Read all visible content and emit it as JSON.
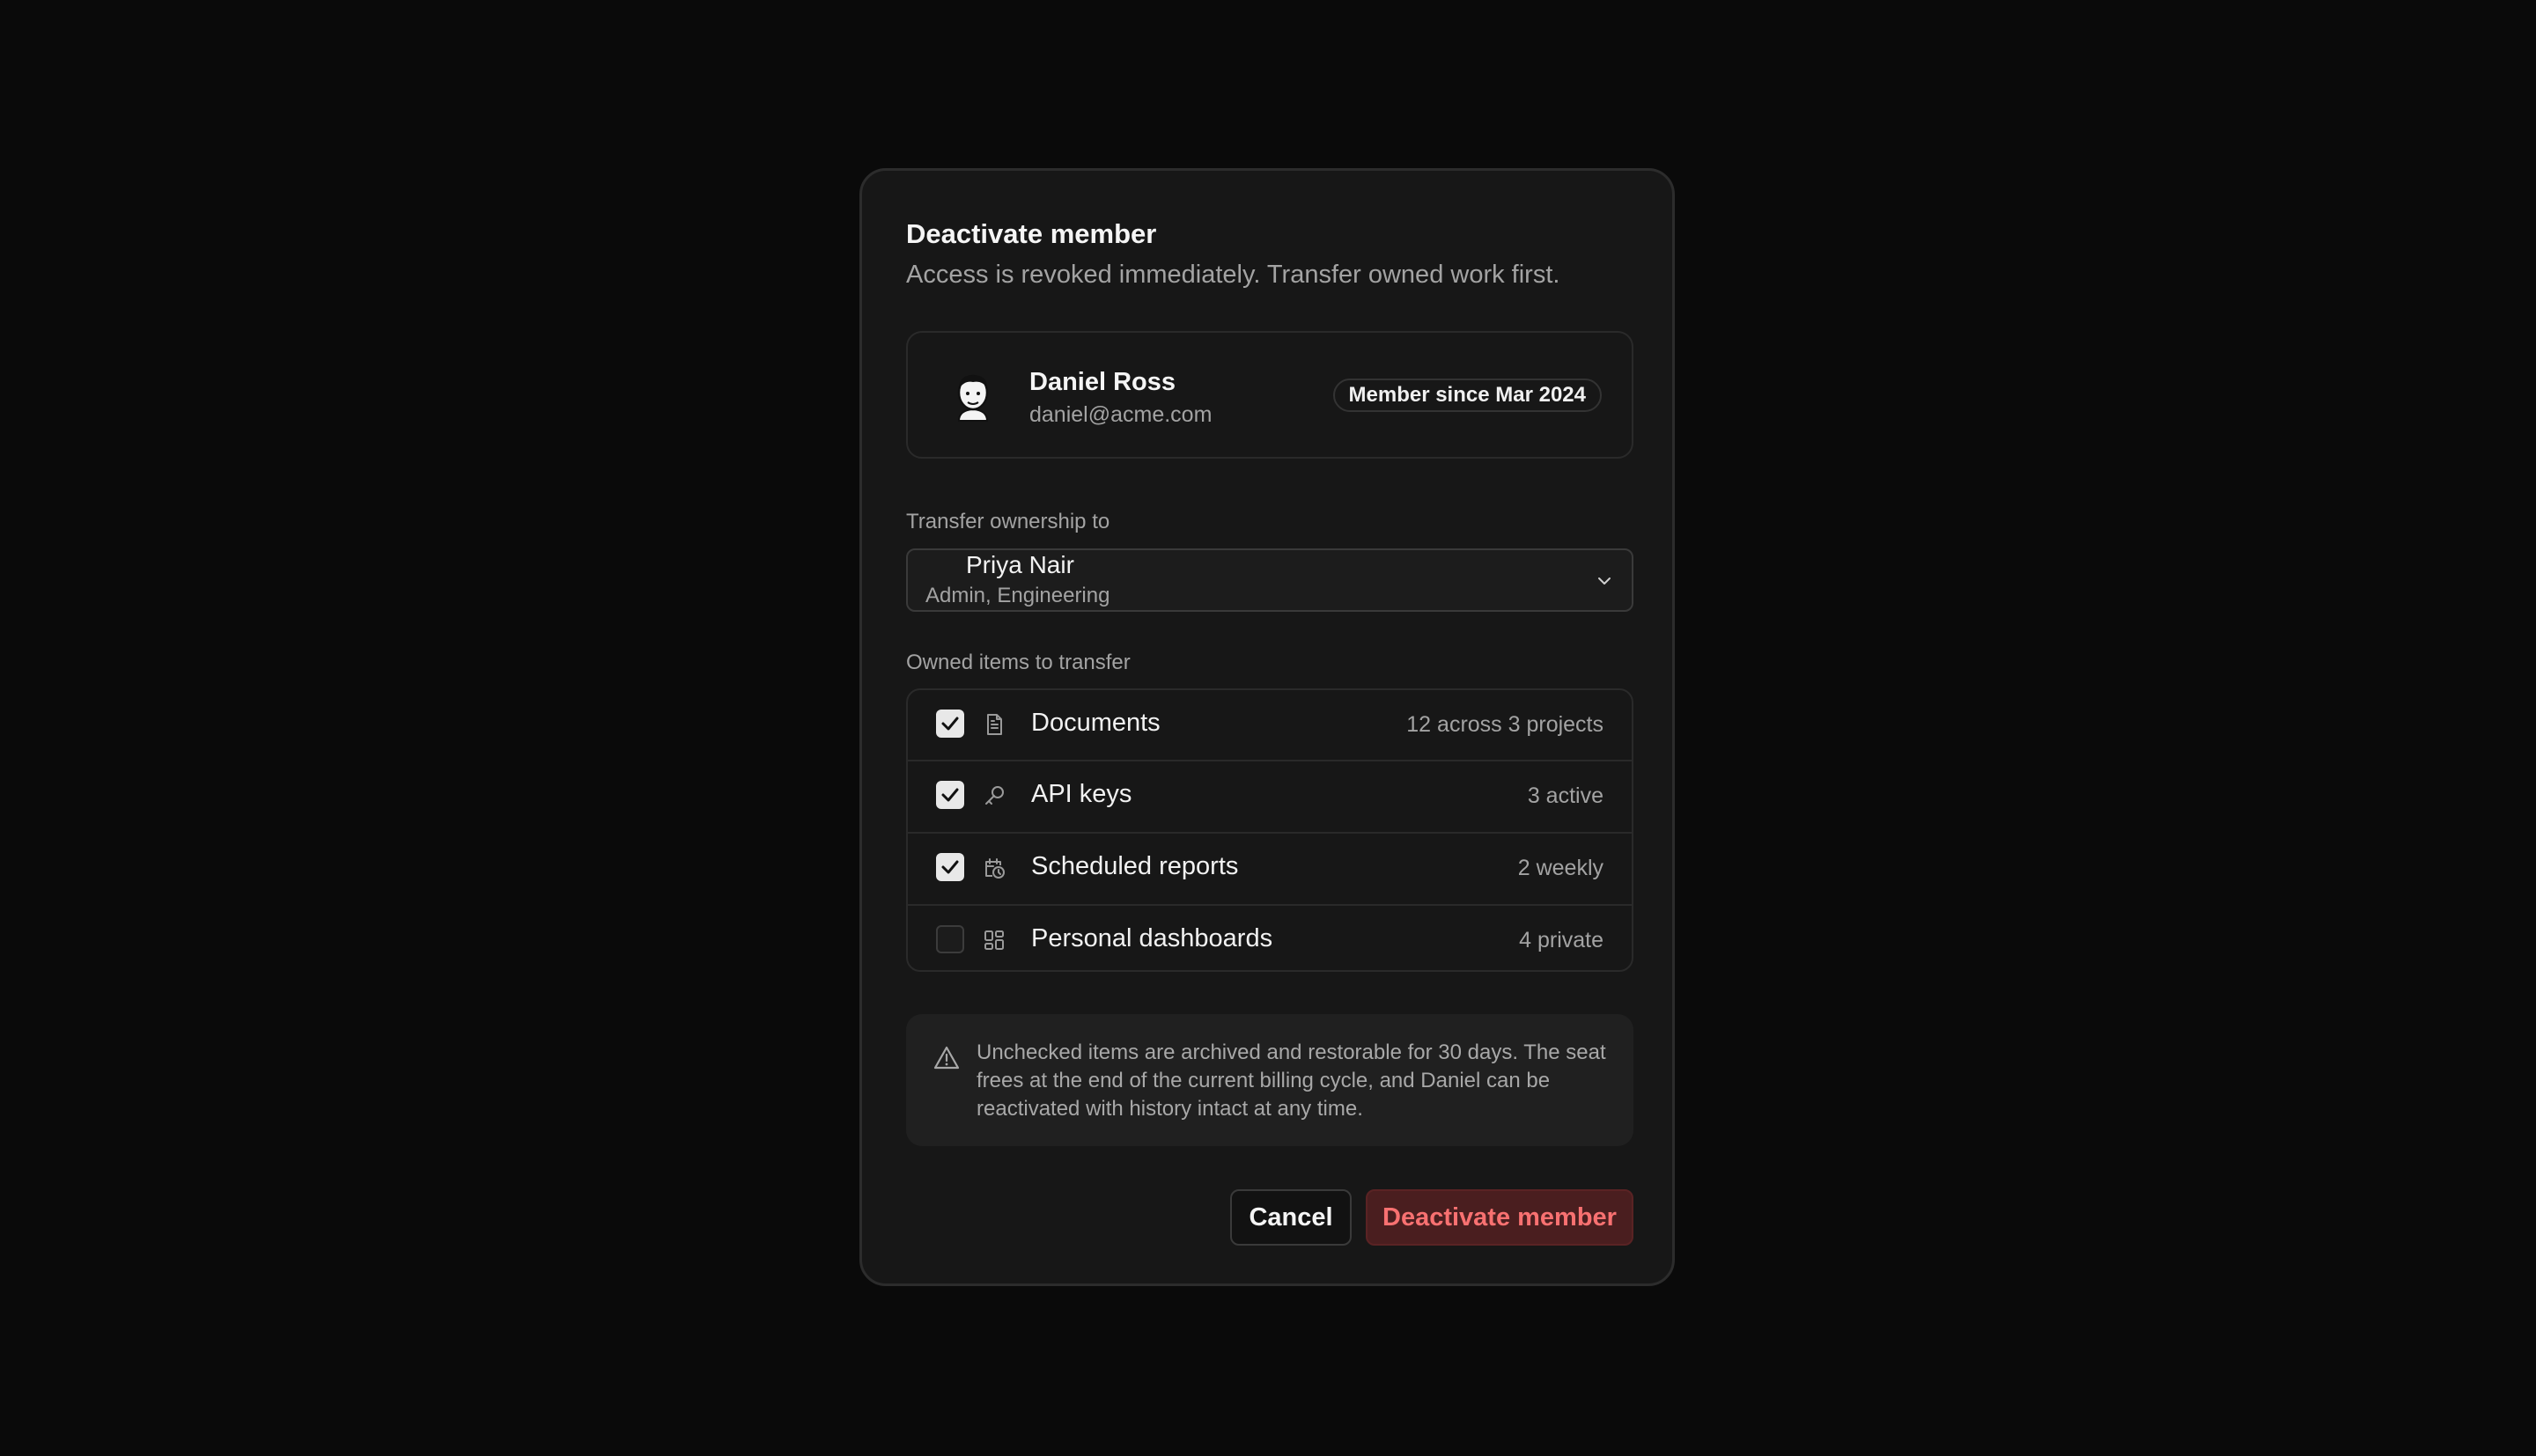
{
  "dialog": {
    "title": "Deactivate member",
    "subtitle": "Access is revoked immediately. Transfer owned work first."
  },
  "member": {
    "avatar_icon": "avatar-illustration",
    "name": "Daniel Ross",
    "email": "daniel@acme.com",
    "since_badge": "Member since Mar 2024"
  },
  "transfer": {
    "label": "Transfer ownership to",
    "selected_name": "Priya Nair",
    "selected_role": "Admin, Engineering",
    "chevron_icon": "chevron-down-icon"
  },
  "owned_items": {
    "label": "Owned items to transfer",
    "items": [
      {
        "label": "Documents",
        "meta": "12 across 3 projects",
        "checked": true,
        "icon": "document-icon"
      },
      {
        "label": "API keys",
        "meta": "3 active",
        "checked": true,
        "icon": "key-icon"
      },
      {
        "label": "Scheduled reports",
        "meta": "2 weekly",
        "checked": true,
        "icon": "calendar-clock-icon"
      },
      {
        "label": "Personal dashboards",
        "meta": "4 private",
        "checked": false,
        "icon": "dashboard-icon"
      }
    ]
  },
  "notice": {
    "icon": "warning-icon",
    "text": "Unchecked items are archived and restorable for 30 days. The seat frees at the end of the current billing cycle, and Daniel can be reactivated with history intact at any time."
  },
  "actions": {
    "cancel_label": "Cancel",
    "confirm_label": "Deactivate member"
  },
  "colors": {
    "background": "#0a0a0a",
    "dialog": "#171717",
    "danger_text": "#f87171",
    "danger_bg": "#4a1e1f"
  }
}
